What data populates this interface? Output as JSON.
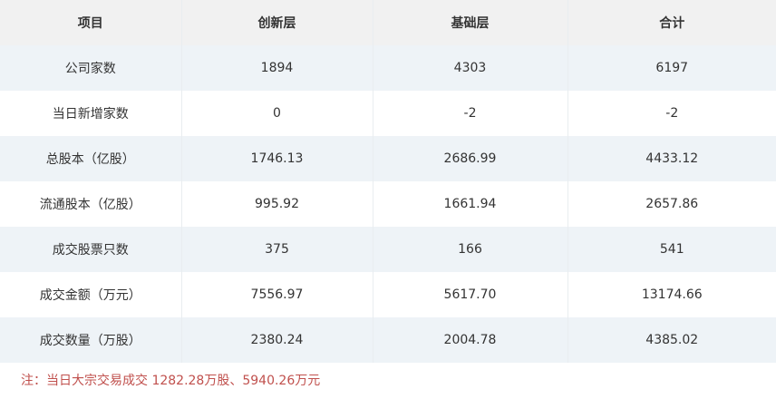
{
  "header": [
    "项目",
    "创新层",
    "基础层",
    "合计"
  ],
  "rows": [
    [
      "公司家数",
      "1894",
      "4303",
      "6197"
    ],
    [
      "当日新增家数",
      "0",
      "-2",
      "-2"
    ],
    [
      "总股本（亿股）",
      "1746.13",
      "2686.99",
      "4433.12"
    ],
    [
      "流通股本（亿股）",
      "995.92",
      "1661.94",
      "2657.86"
    ],
    [
      "成交股票只数",
      "375",
      "166",
      "541"
    ],
    [
      "成交金额（万元）",
      "7556.97",
      "5617.70",
      "13174.66"
    ],
    [
      "成交数量（万股）",
      "2380.24",
      "2004.78",
      "4385.02"
    ]
  ],
  "note": "注：当日大宗交易成交 1282.28万股、5940.26万元",
  "colors": {
    "header_bg": "#f1f1f1",
    "stripe_bg": "#eef3f7",
    "note_text": "#c0504d"
  }
}
